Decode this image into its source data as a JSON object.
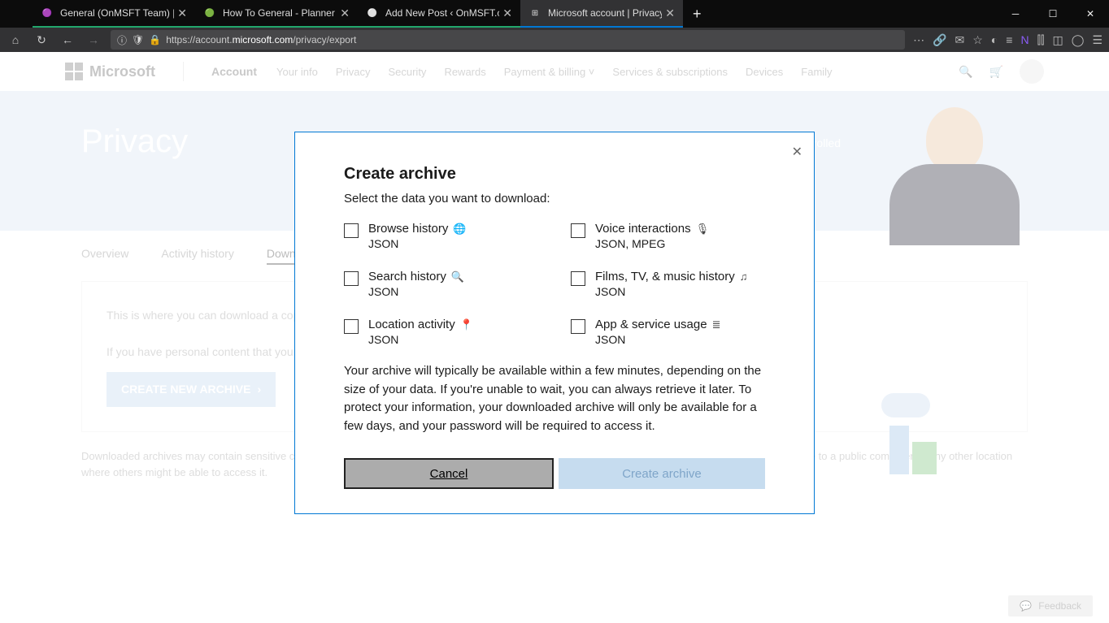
{
  "browser": {
    "tabs": [
      {
        "label": "General (OnMSFT Team) | Micr",
        "active": false,
        "underline": "g"
      },
      {
        "label": "How To General - Planner",
        "active": false,
        "underline": "g"
      },
      {
        "label": "Add New Post ‹ OnMSFT.com — W",
        "active": false,
        "underline": "g"
      },
      {
        "label": "Microsoft account | Privacy",
        "active": true,
        "underline": "b"
      }
    ],
    "url_prefix": "https://account.",
    "url_domain": "microsoft.com",
    "url_path": "/privacy/export"
  },
  "ms_header": {
    "brand": "Microsoft",
    "account": "Account",
    "nav": [
      "Your info",
      "Privacy",
      "Security",
      "Rewards",
      "Payment & billing",
      "Services & subscriptions",
      "Devices",
      "Family"
    ]
  },
  "hero": {
    "title": "Privacy",
    "tag": "controlled"
  },
  "page_tabs": {
    "overview": "Overview",
    "activity": "Activity history",
    "download": "Download your data"
  },
  "content": {
    "p1": "This is where you can download a copy of activity history page.",
    "p2": "If you have personal content that you your email, calendar and photos – yo",
    "button": "CREATE NEW ARCHIVE",
    "foot": "Downloaded archives may contain sensitive content, such as your search history, location information and other personal data. Do not download your archive to a public computer or any other location where others might be able to access it."
  },
  "feedback": "Feedback",
  "modal": {
    "title": "Create archive",
    "subtitle": "Select the data you want to download:",
    "items": [
      {
        "label": "Browse history",
        "format": "JSON",
        "icon": "🌐"
      },
      {
        "label": "Voice interactions",
        "format": "JSON, MPEG",
        "icon": "🎤"
      },
      {
        "label": "Search history",
        "format": "JSON",
        "icon": "🔍"
      },
      {
        "label": "Films, TV, & music history",
        "format": "JSON",
        "icon": "🎵"
      },
      {
        "label": "Location activity",
        "format": "JSON",
        "icon": "📍"
      },
      {
        "label": "App & service usage",
        "format": "JSON",
        "icon": "☰"
      }
    ],
    "description": "Your archive will typically be available within a few minutes, depending on the size of your data. If you're unable to wait, you can always retrieve it later. To protect your information, your downloaded archive will only be available for a few days, and your password will be required to access it.",
    "cancel": "Cancel",
    "create": "Create archive"
  }
}
